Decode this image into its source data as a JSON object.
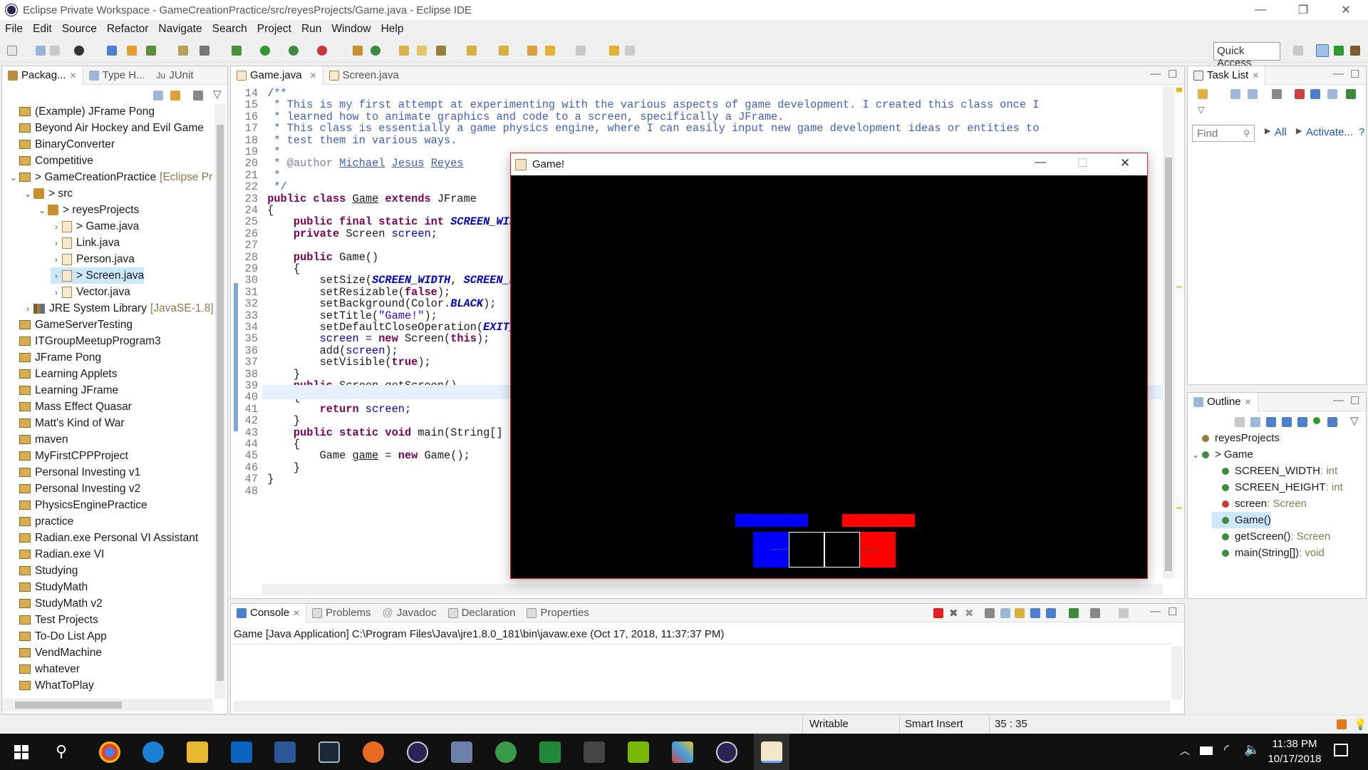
{
  "window": {
    "title": "Eclipse Private Workspace - GameCreationPractice/src/reyesProjects/Game.java - Eclipse IDE",
    "minimize": "—",
    "restore": "❐",
    "close": "✕"
  },
  "menu": [
    "File",
    "Edit",
    "Source",
    "Refactor",
    "Navigate",
    "Search",
    "Project",
    "Run",
    "Window",
    "Help"
  ],
  "quick_access": "Quick Access",
  "package_explorer": {
    "tabs": [
      "Packag...",
      "Type H...",
      "JUnit"
    ],
    "items": [
      {
        "label": "(Example) JFrame Pong",
        "indent": 0
      },
      {
        "label": "Beyond Air Hockey and Evil Game",
        "indent": 0
      },
      {
        "label": "BinaryConverter",
        "indent": 0
      },
      {
        "label": "Competitive",
        "indent": 0
      },
      {
        "label": "> GameCreationPractice",
        "suffix": "[Eclipse Priva",
        "indent": 0,
        "expanded": true
      },
      {
        "label": "> src",
        "indent": 1,
        "expanded": true
      },
      {
        "label": "> reyesProjects",
        "indent": 2,
        "expanded": true
      },
      {
        "label": "> Game.java",
        "indent": 3
      },
      {
        "label": "Link.java",
        "indent": 3
      },
      {
        "label": "Person.java",
        "indent": 3
      },
      {
        "label": "> Screen.java",
        "indent": 3,
        "selected": true
      },
      {
        "label": "Vector.java",
        "indent": 3
      },
      {
        "label": "JRE System Library",
        "suffix": "[JavaSE-1.8]",
        "indent": 1
      },
      {
        "label": "GameServerTesting",
        "indent": 0
      },
      {
        "label": "ITGroupMeetupProgram3",
        "indent": 0
      },
      {
        "label": "JFrame Pong",
        "indent": 0
      },
      {
        "label": "Learning Applets",
        "indent": 0
      },
      {
        "label": "Learning JFrame",
        "indent": 0
      },
      {
        "label": "Mass Effect Quasar",
        "indent": 0
      },
      {
        "label": "Matt's Kind of War",
        "indent": 0
      },
      {
        "label": "maven",
        "indent": 0
      },
      {
        "label": "MyFirstCPPProject",
        "indent": 0
      },
      {
        "label": "Personal Investing v1",
        "indent": 0
      },
      {
        "label": "Personal Investing v2",
        "indent": 0
      },
      {
        "label": "PhysicsEnginePractice",
        "indent": 0
      },
      {
        "label": "practice",
        "indent": 0
      },
      {
        "label": "Radian.exe Personal VI Assistant",
        "indent": 0
      },
      {
        "label": "Radian.exe VI",
        "indent": 0
      },
      {
        "label": "Studying",
        "indent": 0
      },
      {
        "label": "StudyMath",
        "indent": 0
      },
      {
        "label": "StudyMath v2",
        "indent": 0
      },
      {
        "label": "Test Projects",
        "indent": 0
      },
      {
        "label": "To-Do List App",
        "indent": 0
      },
      {
        "label": "VendMachine",
        "indent": 0
      },
      {
        "label": "whatever",
        "indent": 0
      },
      {
        "label": "WhatToPlay",
        "indent": 0
      }
    ]
  },
  "editor": {
    "tabs": [
      "Game.java",
      "Screen.java"
    ],
    "lines": [
      {
        "n": "14",
        "html": "<span class='cmt'>/**</span>"
      },
      {
        "n": "15",
        "html": "<span class='cmt'> * This is my first attempt at experimenting with the various aspects of game development. I created this class once I</span>"
      },
      {
        "n": "16",
        "html": "<span class='cmt'> * learned how to animate graphics and code to a screen, specifically a JFrame.</span>"
      },
      {
        "n": "17",
        "html": "<span class='cmt'> * This class is essentially a game physics engine, where I can easily input new game development ideas or entities to</span>"
      },
      {
        "n": "18",
        "html": "<span class='cmt'> * test them in various ways.</span>"
      },
      {
        "n": "19",
        "html": "<span class='cmt'> *</span>"
      },
      {
        "n": "20",
        "html": "<span class='cmt'> * </span><span class='tag'>@author</span><span class='cmt'> <u>Michael</u> <u>Jesus</u> <u>Reyes</u></span>"
      },
      {
        "n": "21",
        "html": "<span class='cmt'> *</span>"
      },
      {
        "n": "22",
        "html": "<span class='cmt'> */</span>"
      },
      {
        "n": "23",
        "html": "<span class='kw'>public class</span> <u>Game</u> <span class='kw'>extends</span> JFrame"
      },
      {
        "n": "24",
        "html": "{"
      },
      {
        "n": "25",
        "html": "    <span class='kw'>public final static int</span> <span class='sfld'>SCREEN_WIDT</span>"
      },
      {
        "n": "26",
        "html": "    <span class='kw'>private</span> Screen <span class='fld'>screen</span>;"
      },
      {
        "n": "27",
        "html": ""
      },
      {
        "n": "28",
        "html": "    <span class='kw'>public</span> Game()"
      },
      {
        "n": "29",
        "html": "    {"
      },
      {
        "n": "30",
        "html": "        setSize(<span class='sfld'>SCREEN_WIDTH</span>, <span class='sfld'>SCREEN_HE</span>"
      },
      {
        "n": "31",
        "html": "        setResizable(<span class='kw'>false</span>);"
      },
      {
        "n": "32",
        "html": "        setBackground(Color.<span class='sfld'>BLACK</span>);"
      },
      {
        "n": "33",
        "html": "        setTitle(<span class='str'>\"Game!\"</span>);"
      },
      {
        "n": "34",
        "html": "        setDefaultCloseOperation(<span class='sfld'>EXIT_O</span>"
      },
      {
        "n": "35",
        "html": "        <span class='fld'>screen</span> = <span class='kw'>new</span> Screen(<span class='kw'>this</span>);"
      },
      {
        "n": "36",
        "html": "        add(<span class='fld'>screen</span>);"
      },
      {
        "n": "37",
        "html": "        setVisible(<span class='kw'>true</span>);"
      },
      {
        "n": "38",
        "html": "    }"
      },
      {
        "n": "39",
        "html": "    <span class='kw'>public</span> Screen getScreen()"
      },
      {
        "n": "40",
        "html": "    {"
      },
      {
        "n": "41",
        "html": "        <span class='kw'>return</span> <span class='fld'>screen</span>;"
      },
      {
        "n": "42",
        "html": "    }"
      },
      {
        "n": "43",
        "html": "    <span class='kw'>public static void</span> main(String[] ar"
      },
      {
        "n": "44",
        "html": "    {"
      },
      {
        "n": "45",
        "html": "        Game <u>game</u> = <span class='kw'>new</span> Game();"
      },
      {
        "n": "46",
        "html": "    }"
      },
      {
        "n": "47",
        "html": "}"
      },
      {
        "n": "48",
        "html": ""
      }
    ]
  },
  "game_window": {
    "title": "Game!",
    "minimize": "—",
    "maximize": "☐",
    "close": "✕"
  },
  "task_list": {
    "title": "Task List",
    "find_placeholder": "Find",
    "all": "All",
    "activate": "Activate..."
  },
  "outline": {
    "title": "Outline",
    "items": [
      {
        "label": "reyesProjects",
        "type": "",
        "indent": 0,
        "color": "#9b7a3a"
      },
      {
        "label": "> Game",
        "type": "",
        "indent": 0,
        "color": "#3d8b3d",
        "expanded": true
      },
      {
        "label": "SCREEN_WIDTH",
        "type": " : int",
        "indent": 1,
        "color": "#3d8b3d"
      },
      {
        "label": "SCREEN_HEIGHT",
        "type": " : int",
        "indent": 1,
        "color": "#3d8b3d"
      },
      {
        "label": "screen",
        "type": " : Screen",
        "indent": 1,
        "color": "#c23b3b"
      },
      {
        "label": "Game()",
        "type": "",
        "indent": 1,
        "color": "#3d8b3d",
        "selected": true
      },
      {
        "label": "getScreen()",
        "type": " : Screen",
        "indent": 1,
        "color": "#3d8b3d"
      },
      {
        "label": "main(String[])",
        "type": " : void",
        "indent": 1,
        "color": "#3d8b3d"
      }
    ]
  },
  "console": {
    "tabs": [
      "Console",
      "Problems",
      "Javadoc",
      "Declaration",
      "Properties"
    ],
    "launch": "Game [Java Application] C:\\Program Files\\Java\\jre1.8.0_181\\bin\\javaw.exe (Oct 17, 2018, 11:37:37 PM)"
  },
  "status": {
    "writable": "Writable",
    "insert": "Smart Insert",
    "position": "35 : 35"
  },
  "taskbar": {
    "time": "11:38 PM",
    "date": "10/17/2018"
  },
  "colors": {
    "paddle_blue": "#0000ff",
    "paddle_red": "#ff0000",
    "accent": "#3399ff"
  }
}
